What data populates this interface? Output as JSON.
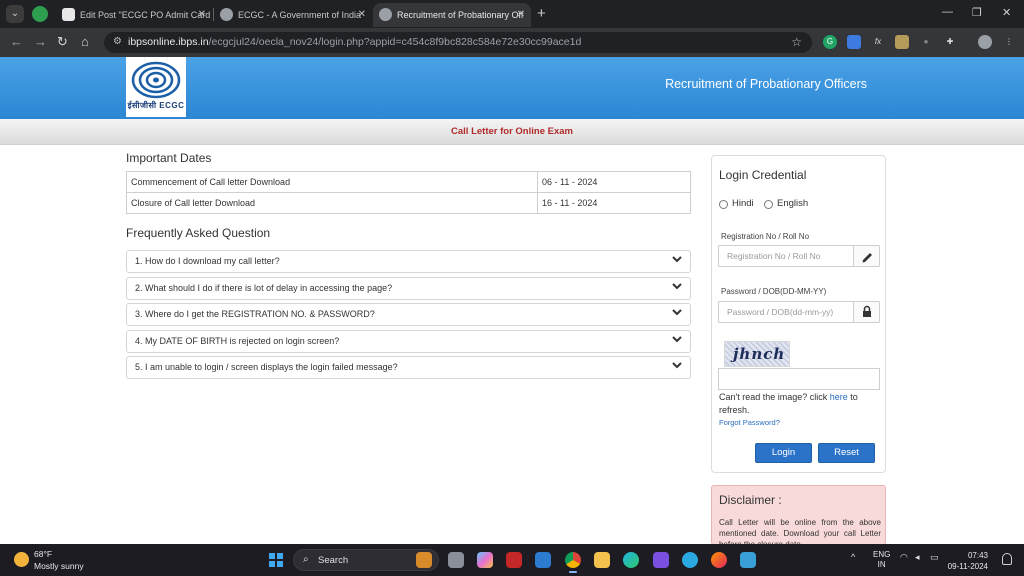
{
  "browser": {
    "tabs": [
      {
        "title": "Edit Post \"ECGC PO Admit Card",
        "active": false
      },
      {
        "title": "ECGC - A Government of India",
        "active": false
      },
      {
        "title": "Recruitment of Probationary Off",
        "active": true
      }
    ],
    "url_host": "ibpsonline.ibps.in",
    "url_rest": "/ecgcjul24/oecla_nov24/login.php?appid=c454c8f9bc828c584e72e30cc99ace1d"
  },
  "header": {
    "logo_text": "ईसीजीसी ECGC",
    "title": "Recruitment of Probationary Officers",
    "subtitle": "Call Letter for Online Exam"
  },
  "important_dates": {
    "heading": "Important Dates",
    "rows": [
      {
        "label": "Commencement of Call letter Download",
        "value": "06 - 11 - 2024"
      },
      {
        "label": "Closure of Call letter Download",
        "value": "16 - 11 - 2024"
      }
    ]
  },
  "faq": {
    "heading": "Frequently Asked Question",
    "items": [
      "1. How do I download my call letter?",
      "2. What should I do if there is lot of delay in accessing the page?",
      "3. Where do I get the REGISTRATION NO. & PASSWORD?",
      "4. My DATE OF BIRTH is rejected on login screen?",
      "5. I am unable to login / screen displays the login failed message?"
    ]
  },
  "login": {
    "title": "Login Credential",
    "lang_hindi": "Hindi",
    "lang_english": "English",
    "reg_label": "Registration No / Roll No",
    "reg_placeholder": "Registration No / Roll No",
    "pwd_label": "Password / DOB(DD-MM-YY)",
    "pwd_placeholder": "Password / DOB(dd-mm-yy)",
    "captcha_text": "jhnch",
    "captcha_note_pre": "Can't read the image? click ",
    "captcha_note_link": "here",
    "captcha_note_post": " to refresh.",
    "forgot": "Forgot Password?",
    "login_btn": "Login",
    "reset_btn": "Reset"
  },
  "disclaimer": {
    "title": "Disclaimer :",
    "text": "Call Letter will be online from the above mentioned date. Download your call Letter before the closure date."
  },
  "taskbar": {
    "temperature": "68°F",
    "weather": "Mostly sunny",
    "search": "Search",
    "lang_line1": "ENG",
    "lang_line2": "IN",
    "time": "07:43",
    "date": "09-11-2024"
  }
}
